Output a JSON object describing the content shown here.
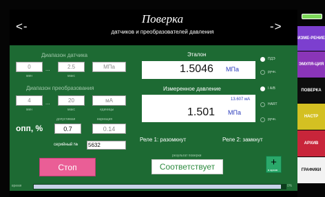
{
  "header": {
    "title": "Поверка",
    "subtitle": "датчиков и преобразователей давления",
    "nav_left": "<-",
    "nav_right": "->"
  },
  "sensor_range": {
    "label": "Диапазон датчика",
    "min": "0",
    "max": "2.5",
    "unit": "МПа",
    "min_caption": "мин",
    "max_caption": "макс",
    "dots": "..."
  },
  "conversion_range": {
    "label": "Диапазон преобразования",
    "min": "4",
    "max": "20",
    "unit": "мА",
    "min_caption": "мин",
    "max_caption": "макс",
    "unit_caption": "единицы",
    "dots": "..."
  },
  "tolerance": {
    "label": "опп, %",
    "allowed_caption": "допустимая",
    "variation_caption": "вариация",
    "allowed": "0.7",
    "variation": "0.14"
  },
  "serial": {
    "label": "серийный №",
    "value": "5632"
  },
  "etalon": {
    "label": "Эталон",
    "value": "1.5046",
    "unit": "МПа"
  },
  "measured": {
    "label": "Измеренное давление",
    "current": "13.607 мА",
    "value": "1.501",
    "unit": "МПа"
  },
  "radios_etalon": [
    {
      "label": "ПДЭ",
      "selected": true
    },
    {
      "label": "ручн.",
      "selected": false
    }
  ],
  "radios_measured": [
    {
      "label": "I А/В",
      "selected": true
    },
    {
      "label": "HART",
      "selected": false
    },
    {
      "label": "ручн.",
      "selected": false
    }
  ],
  "relays": {
    "relay1": "Реле 1: разомкнут",
    "relay2": "Реле 2: замкнут"
  },
  "result": {
    "label": "результат поверки",
    "value": "Соответствует"
  },
  "buttons": {
    "stop": "Стоп",
    "add_symbol": "+",
    "add_caption": "в архив"
  },
  "progress": {
    "label": "время",
    "percent_text": "0%",
    "fraction": 0.98
  },
  "side_tabs": [
    {
      "label": "ИЗМЕ-РЕНИЕ",
      "color": "#7c3fcf"
    },
    {
      "label": "ЭМУЛЯ-ЦИЯ",
      "color": "#8a35b8"
    },
    {
      "label": "ПОВЕРКА",
      "color": "#0d0d0d"
    },
    {
      "label": "НАСТР",
      "color": "#d4c022"
    },
    {
      "label": "АРХИВ",
      "color": "#c8253a"
    },
    {
      "label": "ГРАФИКИ",
      "color": "#f2f2f2"
    }
  ],
  "colors": {
    "panel_bg": "#1d6a33",
    "stop_button": "#ea5e96",
    "accent_value": "#2a3bbb",
    "result_text": "#2d8b3f",
    "battery": "#7dd85a"
  }
}
